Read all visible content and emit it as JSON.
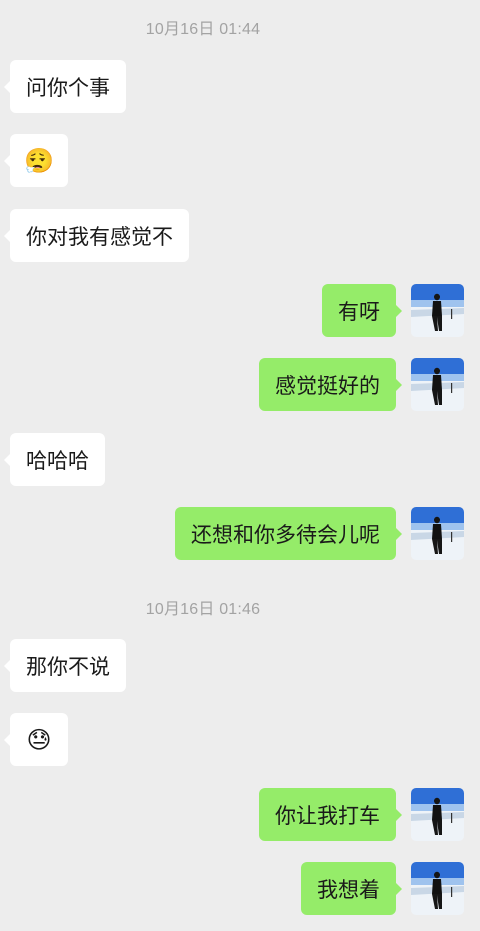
{
  "chat": {
    "timestamps": [
      "10月16日 01:44",
      "10月16日 01:46"
    ],
    "messages": [
      {
        "side": "in",
        "text": "问你个事"
      },
      {
        "side": "in",
        "text": "😮‍💨"
      },
      {
        "side": "in",
        "text": "你对我有感觉不"
      },
      {
        "side": "out",
        "text": "有呀"
      },
      {
        "side": "out",
        "text": "感觉挺好的"
      },
      {
        "side": "in",
        "text": "哈哈哈"
      },
      {
        "side": "out",
        "text": "还想和你多待会儿呢"
      },
      {
        "side": "in",
        "text": "那你不说"
      },
      {
        "side": "in",
        "text": "😓"
      },
      {
        "side": "out",
        "text": "你让我打车"
      },
      {
        "side": "out",
        "text": "我想着"
      }
    ]
  },
  "colors": {
    "background": "#ededed",
    "incoming_bubble": "#ffffff",
    "outgoing_bubble": "#95ec69",
    "timestamp": "#a3a3a3"
  },
  "icons": {
    "self_avatar": "snow-landscape-avatar-icon"
  }
}
